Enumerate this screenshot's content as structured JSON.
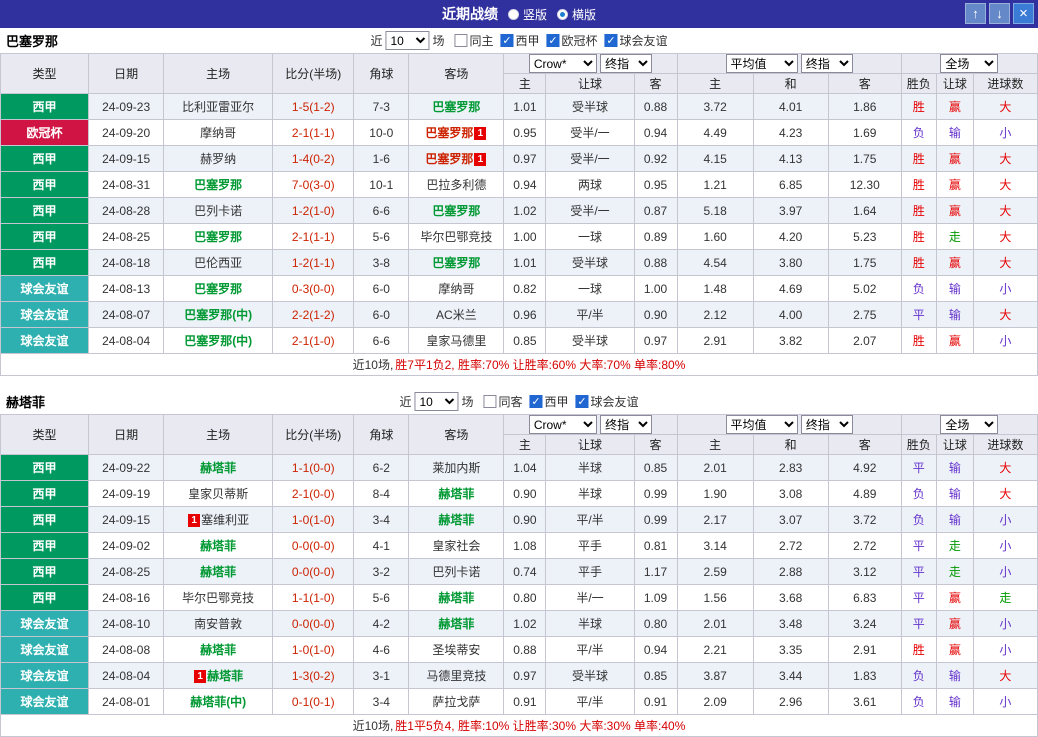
{
  "titlebar": {
    "title": "近期战绩",
    "radios": [
      {
        "label": "竖版",
        "selected": false
      },
      {
        "label": "横版",
        "selected": true
      }
    ],
    "up_icon": "↑",
    "down_icon": "↓",
    "close_icon": "×"
  },
  "columns": {
    "type": "类型",
    "date": "日期",
    "home": "主场",
    "score": "比分(半场)",
    "corner": "角球",
    "away": "客场",
    "sub": [
      "主",
      "让球",
      "客",
      "主",
      "和",
      "客",
      "胜负",
      "让球",
      "进球数"
    ]
  },
  "selects": {
    "bookmaker": "Crow*",
    "final": "终指",
    "average": "平均值",
    "scope": "全场"
  },
  "colors": {
    "league": {
      "西甲": "#009a60",
      "欧冠杯": "#d01545",
      "球会友谊": "#2fb0b0"
    },
    "team": {
      "green": "#009933",
      "black": "#333333",
      "red": "#cc2200"
    },
    "result": {
      "red": "#e60000",
      "purple": "#6633cc",
      "green": "#009900"
    }
  },
  "sections": [
    {
      "team": "巴塞罗那",
      "filter": {
        "near": "近",
        "count": "10",
        "games": "场",
        "checkboxes": [
          {
            "label": "同主",
            "checked": false
          },
          {
            "label": "西甲",
            "checked": true
          },
          {
            "label": "欧冠杯",
            "checked": true
          },
          {
            "label": "球会友谊",
            "checked": true
          }
        ]
      },
      "rows": [
        {
          "league": "西甲",
          "date": "24-09-23",
          "home": {
            "name": "比利亚雷亚尔",
            "color": "black"
          },
          "score": "1-5(1-2)",
          "corner": "7-3",
          "away": {
            "name": "巴塞罗那",
            "color": "green"
          },
          "odds": [
            "1.01",
            "受半球",
            "0.88"
          ],
          "avg": [
            "3.72",
            "4.01",
            "1.86"
          ],
          "result": [
            "胜",
            "red"
          ],
          "handicap": [
            "赢",
            "red"
          ],
          "goals": [
            "大",
            "red"
          ]
        },
        {
          "league": "欧冠杯",
          "date": "24-09-20",
          "home": {
            "name": "摩纳哥",
            "color": "black"
          },
          "score": "2-1(1-1)",
          "corner": "10-0",
          "away": {
            "name": "巴塞罗那",
            "color": "red",
            "badge": "1",
            "badge_pos": "after"
          },
          "odds": [
            "0.95",
            "受半/一",
            "0.94"
          ],
          "avg": [
            "4.49",
            "4.23",
            "1.69"
          ],
          "result": [
            "负",
            "purple"
          ],
          "handicap": [
            "输",
            "purple"
          ],
          "goals": [
            "小",
            "purple"
          ]
        },
        {
          "league": "西甲",
          "date": "24-09-15",
          "home": {
            "name": "赫罗纳",
            "color": "black"
          },
          "score": "1-4(0-2)",
          "corner": "1-6",
          "away": {
            "name": "巴塞罗那",
            "color": "red",
            "badge": "1",
            "badge_pos": "after"
          },
          "odds": [
            "0.97",
            "受半/一",
            "0.92"
          ],
          "avg": [
            "4.15",
            "4.13",
            "1.75"
          ],
          "result": [
            "胜",
            "red"
          ],
          "handicap": [
            "赢",
            "red"
          ],
          "goals": [
            "大",
            "red"
          ]
        },
        {
          "league": "西甲",
          "date": "24-08-31",
          "home": {
            "name": "巴塞罗那",
            "color": "green"
          },
          "score": "7-0(3-0)",
          "corner": "10-1",
          "away": {
            "name": "巴拉多利德",
            "color": "black"
          },
          "odds": [
            "0.94",
            "两球",
            "0.95"
          ],
          "avg": [
            "1.21",
            "6.85",
            "12.30"
          ],
          "result": [
            "胜",
            "red"
          ],
          "handicap": [
            "赢",
            "red"
          ],
          "goals": [
            "大",
            "red"
          ]
        },
        {
          "league": "西甲",
          "date": "24-08-28",
          "home": {
            "name": "巴列卡诺",
            "color": "black"
          },
          "score": "1-2(1-0)",
          "corner": "6-6",
          "away": {
            "name": "巴塞罗那",
            "color": "green"
          },
          "odds": [
            "1.02",
            "受半/一",
            "0.87"
          ],
          "avg": [
            "5.18",
            "3.97",
            "1.64"
          ],
          "result": [
            "胜",
            "red"
          ],
          "handicap": [
            "赢",
            "red"
          ],
          "goals": [
            "大",
            "red"
          ]
        },
        {
          "league": "西甲",
          "date": "24-08-25",
          "home": {
            "name": "巴塞罗那",
            "color": "green"
          },
          "score": "2-1(1-1)",
          "corner": "5-6",
          "away": {
            "name": "毕尔巴鄂竞技",
            "color": "black"
          },
          "odds": [
            "1.00",
            "一球",
            "0.89"
          ],
          "avg": [
            "1.60",
            "4.20",
            "5.23"
          ],
          "result": [
            "胜",
            "red"
          ],
          "handicap": [
            "走",
            "green"
          ],
          "goals": [
            "大",
            "red"
          ]
        },
        {
          "league": "西甲",
          "date": "24-08-18",
          "home": {
            "name": "巴伦西亚",
            "color": "black"
          },
          "score": "1-2(1-1)",
          "corner": "3-8",
          "away": {
            "name": "巴塞罗那",
            "color": "green"
          },
          "odds": [
            "1.01",
            "受半球",
            "0.88"
          ],
          "avg": [
            "4.54",
            "3.80",
            "1.75"
          ],
          "result": [
            "胜",
            "red"
          ],
          "handicap": [
            "赢",
            "red"
          ],
          "goals": [
            "大",
            "red"
          ]
        },
        {
          "league": "球会友谊",
          "date": "24-08-13",
          "home": {
            "name": "巴塞罗那",
            "color": "green"
          },
          "score": "0-3(0-0)",
          "corner": "6-0",
          "away": {
            "name": "摩纳哥",
            "color": "black"
          },
          "odds": [
            "0.82",
            "一球",
            "1.00"
          ],
          "avg": [
            "1.48",
            "4.69",
            "5.02"
          ],
          "result": [
            "负",
            "purple"
          ],
          "handicap": [
            "输",
            "purple"
          ],
          "goals": [
            "小",
            "purple"
          ]
        },
        {
          "league": "球会友谊",
          "date": "24-08-07",
          "home": {
            "name": "巴塞罗那(中)",
            "color": "green"
          },
          "score": "2-2(1-2)",
          "corner": "6-0",
          "away": {
            "name": "AC米兰",
            "color": "black"
          },
          "odds": [
            "0.96",
            "平/半",
            "0.90"
          ],
          "avg": [
            "2.12",
            "4.00",
            "2.75"
          ],
          "result": [
            "平",
            "purple"
          ],
          "handicap": [
            "输",
            "purple"
          ],
          "goals": [
            "大",
            "red"
          ]
        },
        {
          "league": "球会友谊",
          "date": "24-08-04",
          "home": {
            "name": "巴塞罗那(中)",
            "color": "green"
          },
          "score": "2-1(1-0)",
          "corner": "6-6",
          "away": {
            "name": "皇家马德里",
            "color": "black"
          },
          "odds": [
            "0.85",
            "受半球",
            "0.97"
          ],
          "avg": [
            "2.91",
            "3.82",
            "2.07"
          ],
          "result": [
            "胜",
            "red"
          ],
          "handicap": [
            "赢",
            "red"
          ],
          "goals": [
            "小",
            "purple"
          ]
        }
      ],
      "summary": {
        "prefix": "近10场,",
        "stats": "胜7平1负2, 胜率:70% 让胜率:60% 大率:70% 单率:80%"
      }
    },
    {
      "team": "赫塔菲",
      "filter": {
        "near": "近",
        "count": "10",
        "games": "场",
        "checkboxes": [
          {
            "label": "同客",
            "checked": false
          },
          {
            "label": "西甲",
            "checked": true
          },
          {
            "label": "球会友谊",
            "checked": true
          }
        ]
      },
      "rows": [
        {
          "league": "西甲",
          "date": "24-09-22",
          "home": {
            "name": "赫塔菲",
            "color": "green"
          },
          "score": "1-1(0-0)",
          "corner": "6-2",
          "away": {
            "name": "莱加内斯",
            "color": "black"
          },
          "odds": [
            "1.04",
            "半球",
            "0.85"
          ],
          "avg": [
            "2.01",
            "2.83",
            "4.92"
          ],
          "result": [
            "平",
            "purple"
          ],
          "handicap": [
            "输",
            "purple"
          ],
          "goals": [
            "大",
            "red"
          ]
        },
        {
          "league": "西甲",
          "date": "24-09-19",
          "home": {
            "name": "皇家贝蒂斯",
            "color": "black"
          },
          "score": "2-1(0-0)",
          "corner": "8-4",
          "away": {
            "name": "赫塔菲",
            "color": "green"
          },
          "odds": [
            "0.90",
            "半球",
            "0.99"
          ],
          "avg": [
            "1.90",
            "3.08",
            "4.89"
          ],
          "result": [
            "负",
            "purple"
          ],
          "handicap": [
            "输",
            "purple"
          ],
          "goals": [
            "大",
            "red"
          ]
        },
        {
          "league": "西甲",
          "date": "24-09-15",
          "home": {
            "name": "塞维利亚",
            "color": "black",
            "badge": "1",
            "badge_pos": "before"
          },
          "score": "1-0(1-0)",
          "corner": "3-4",
          "away": {
            "name": "赫塔菲",
            "color": "green"
          },
          "odds": [
            "0.90",
            "平/半",
            "0.99"
          ],
          "avg": [
            "2.17",
            "3.07",
            "3.72"
          ],
          "result": [
            "负",
            "purple"
          ],
          "handicap": [
            "输",
            "purple"
          ],
          "goals": [
            "小",
            "purple"
          ]
        },
        {
          "league": "西甲",
          "date": "24-09-02",
          "home": {
            "name": "赫塔菲",
            "color": "green"
          },
          "score": "0-0(0-0)",
          "corner": "4-1",
          "away": {
            "name": "皇家社会",
            "color": "black"
          },
          "odds": [
            "1.08",
            "平手",
            "0.81"
          ],
          "avg": [
            "3.14",
            "2.72",
            "2.72"
          ],
          "result": [
            "平",
            "purple"
          ],
          "handicap": [
            "走",
            "green"
          ],
          "goals": [
            "小",
            "purple"
          ]
        },
        {
          "league": "西甲",
          "date": "24-08-25",
          "home": {
            "name": "赫塔菲",
            "color": "green"
          },
          "score": "0-0(0-0)",
          "corner": "3-2",
          "away": {
            "name": "巴列卡诺",
            "color": "black"
          },
          "odds": [
            "0.74",
            "平手",
            "1.17"
          ],
          "avg": [
            "2.59",
            "2.88",
            "3.12"
          ],
          "result": [
            "平",
            "purple"
          ],
          "handicap": [
            "走",
            "green"
          ],
          "goals": [
            "小",
            "purple"
          ]
        },
        {
          "league": "西甲",
          "date": "24-08-16",
          "home": {
            "name": "毕尔巴鄂竞技",
            "color": "black"
          },
          "score": "1-1(1-0)",
          "corner": "5-6",
          "away": {
            "name": "赫塔菲",
            "color": "green"
          },
          "odds": [
            "0.80",
            "半/一",
            "1.09"
          ],
          "avg": [
            "1.56",
            "3.68",
            "6.83"
          ],
          "result": [
            "平",
            "purple"
          ],
          "handicap": [
            "赢",
            "red"
          ],
          "goals": [
            "走",
            "green"
          ]
        },
        {
          "league": "球会友谊",
          "date": "24-08-10",
          "home": {
            "name": "南安普敦",
            "color": "black"
          },
          "score": "0-0(0-0)",
          "corner": "4-2",
          "away": {
            "name": "赫塔菲",
            "color": "green"
          },
          "odds": [
            "1.02",
            "半球",
            "0.80"
          ],
          "avg": [
            "2.01",
            "3.48",
            "3.24"
          ],
          "result": [
            "平",
            "purple"
          ],
          "handicap": [
            "赢",
            "red"
          ],
          "goals": [
            "小",
            "purple"
          ]
        },
        {
          "league": "球会友谊",
          "date": "24-08-08",
          "home": {
            "name": "赫塔菲",
            "color": "green"
          },
          "score": "1-0(1-0)",
          "corner": "4-6",
          "away": {
            "name": "圣埃蒂安",
            "color": "black"
          },
          "odds": [
            "0.88",
            "平/半",
            "0.94"
          ],
          "avg": [
            "2.21",
            "3.35",
            "2.91"
          ],
          "result": [
            "胜",
            "red"
          ],
          "handicap": [
            "赢",
            "red"
          ],
          "goals": [
            "小",
            "purple"
          ]
        },
        {
          "league": "球会友谊",
          "date": "24-08-04",
          "home": {
            "name": "赫塔菲",
            "color": "green",
            "badge": "1",
            "badge_pos": "before"
          },
          "score": "1-3(0-2)",
          "corner": "3-1",
          "away": {
            "name": "马德里竞技",
            "color": "black"
          },
          "odds": [
            "0.97",
            "受半球",
            "0.85"
          ],
          "avg": [
            "3.87",
            "3.44",
            "1.83"
          ],
          "result": [
            "负",
            "purple"
          ],
          "handicap": [
            "输",
            "purple"
          ],
          "goals": [
            "大",
            "red"
          ]
        },
        {
          "league": "球会友谊",
          "date": "24-08-01",
          "home": {
            "name": "赫塔菲(中)",
            "color": "green"
          },
          "score": "0-1(0-1)",
          "corner": "3-4",
          "away": {
            "name": "萨拉戈萨",
            "color": "black"
          },
          "odds": [
            "0.91",
            "平/半",
            "0.91"
          ],
          "avg": [
            "2.09",
            "2.96",
            "3.61"
          ],
          "result": [
            "负",
            "purple"
          ],
          "handicap": [
            "输",
            "purple"
          ],
          "goals": [
            "小",
            "purple"
          ]
        }
      ],
      "summary": {
        "prefix": "近10场,",
        "stats": "胜1平5负4, 胜率:10% 让胜率:30% 大率:30% 单率:40%"
      }
    }
  ]
}
